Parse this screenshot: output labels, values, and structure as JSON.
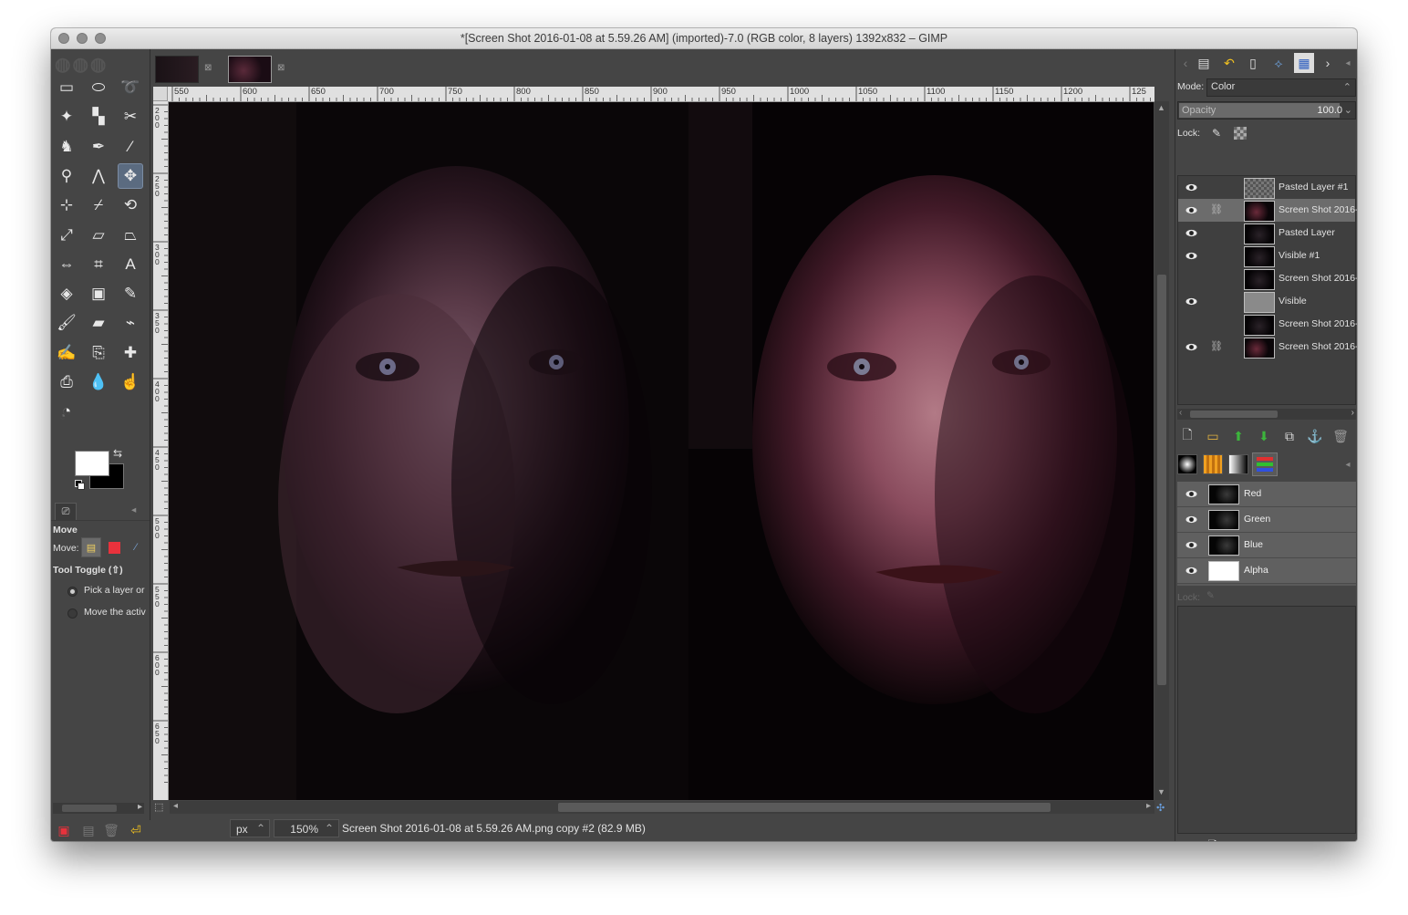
{
  "window": {
    "title": "*[Screen Shot 2016-01-08 at 5.59.26 AM] (imported)-7.0 (RGB color, 8 layers) 1392x832 – GIMP"
  },
  "toolbox": {
    "tools": [
      {
        "name": "rect-select-icon",
        "glyph": "▭"
      },
      {
        "name": "ellipse-select-icon",
        "glyph": "⬭"
      },
      {
        "name": "free-select-icon",
        "glyph": "➰"
      },
      {
        "name": "fuzzy-select-icon",
        "glyph": "✦"
      },
      {
        "name": "select-by-color-icon",
        "glyph": "▚"
      },
      {
        "name": "scissors-select-icon",
        "glyph": "✂"
      },
      {
        "name": "foreground-select-icon",
        "glyph": "♞"
      },
      {
        "name": "paths-icon",
        "glyph": "✒"
      },
      {
        "name": "color-picker-icon",
        "glyph": "⁄"
      },
      {
        "name": "zoom-icon",
        "glyph": "⚲"
      },
      {
        "name": "measure-icon",
        "glyph": "⋀"
      },
      {
        "name": "move-icon",
        "glyph": "✥"
      },
      {
        "name": "align-icon",
        "glyph": "⊹"
      },
      {
        "name": "crop-icon",
        "glyph": "⌿"
      },
      {
        "name": "rotate-icon",
        "glyph": "⟲"
      },
      {
        "name": "scale-icon",
        "glyph": "⤢"
      },
      {
        "name": "shear-icon",
        "glyph": "▱"
      },
      {
        "name": "perspective-icon",
        "glyph": "⏢"
      },
      {
        "name": "flip-icon",
        "glyph": "⇔"
      },
      {
        "name": "cage-transform-icon",
        "glyph": "⌗"
      },
      {
        "name": "text-icon",
        "glyph": "A"
      },
      {
        "name": "bucket-fill-icon",
        "glyph": "◈"
      },
      {
        "name": "blend-icon",
        "glyph": "▣"
      },
      {
        "name": "pencil-icon",
        "glyph": "✎"
      },
      {
        "name": "paintbrush-icon",
        "glyph": "🖌"
      },
      {
        "name": "eraser-icon",
        "glyph": "▰"
      },
      {
        "name": "airbrush-icon",
        "glyph": "⌁"
      },
      {
        "name": "ink-icon",
        "glyph": "✍"
      },
      {
        "name": "clone-icon",
        "glyph": "⎘"
      },
      {
        "name": "heal-icon",
        "glyph": "✚"
      },
      {
        "name": "perspective-clone-icon",
        "glyph": "⎙"
      },
      {
        "name": "blur-icon",
        "glyph": "💧"
      },
      {
        "name": "smudge-icon",
        "glyph": "☝"
      },
      {
        "name": "dodge-burn-icon",
        "glyph": "◔"
      }
    ],
    "options_title": "Move",
    "move_label": "Move:",
    "tool_toggle_label": "Tool Toggle  (⇧)",
    "radio_options": [
      "Pick a layer or g",
      "Move the active"
    ]
  },
  "ruler": {
    "h_ticks": [
      "550",
      "600",
      "650",
      "700",
      "750",
      "800",
      "850",
      "900",
      "950",
      "1000",
      "1050",
      "1100",
      "1150",
      "1200",
      "125"
    ],
    "v_ticks": [
      "200",
      "250",
      "300",
      "350",
      "400",
      "450",
      "500",
      "550",
      "600",
      "650"
    ]
  },
  "status": {
    "unit": "px",
    "zoom": "150%",
    "text": "Screen Shot 2016-01-08 at 5.59.26 AM.png copy #2 (82.9 MB)"
  },
  "layers_panel": {
    "mode_label": "Mode:",
    "mode_value": "Color",
    "opacity_label": "Opacity",
    "opacity_value": "100.0",
    "opacity_fraction": 1.0,
    "lock_label": "Lock:",
    "layers": [
      {
        "name": "Pasted Layer #1",
        "visible": true,
        "chain": false,
        "selected": false
      },
      {
        "name": "Screen Shot 2016-",
        "visible": true,
        "chain": true,
        "selected": true
      },
      {
        "name": "Pasted Layer",
        "visible": true,
        "chain": false,
        "selected": false
      },
      {
        "name": "Visible #1",
        "visible": true,
        "chain": false,
        "selected": false
      },
      {
        "name": "Screen Shot 2016-",
        "visible": false,
        "chain": false,
        "selected": false
      },
      {
        "name": "Visible",
        "visible": true,
        "chain": false,
        "selected": false
      },
      {
        "name": "Screen Shot 2016-",
        "visible": false,
        "chain": false,
        "selected": false
      },
      {
        "name": "Screen Shot 2016-",
        "visible": true,
        "chain": true,
        "selected": false
      }
    ]
  },
  "channels_panel": {
    "channels": [
      {
        "name": "Red"
      },
      {
        "name": "Green"
      },
      {
        "name": "Blue"
      },
      {
        "name": "Alpha"
      }
    ],
    "lock_label": "Lock:"
  }
}
